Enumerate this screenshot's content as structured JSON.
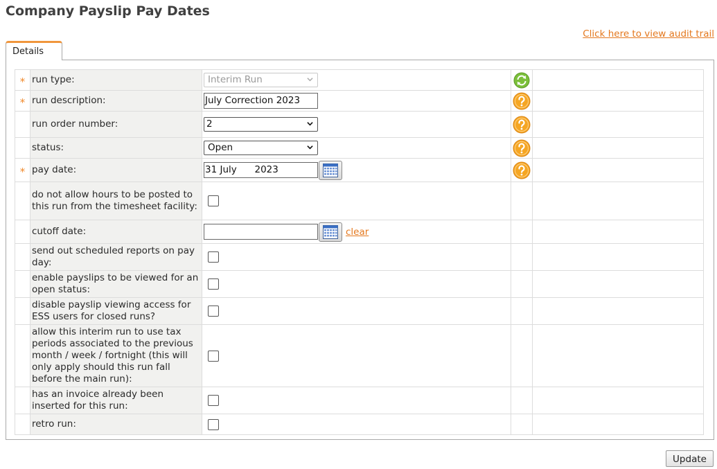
{
  "page": {
    "title": "Company Payslip Pay Dates",
    "audit_link": "Click here to view audit trail",
    "tab_label": "Details",
    "update_label": "Update"
  },
  "fields": {
    "run_type": {
      "required": "*",
      "label": "run type:",
      "value": "Interim Run"
    },
    "run_description": {
      "required": "*",
      "label": "run description:",
      "value": "July Correction 2023"
    },
    "run_order_number": {
      "label": "run order number:",
      "value": "2"
    },
    "status": {
      "label": "status:",
      "value": "Open"
    },
    "pay_date": {
      "required": "*",
      "label": "pay date:",
      "value": "31 July      2023"
    },
    "no_timesheet_hours": {
      "label": "do not allow hours to be posted to this run from the timesheet facility:",
      "checked": false
    },
    "cutoff_date": {
      "label": "cutoff date:",
      "value": "",
      "clear_label": "clear"
    },
    "scheduled_reports": {
      "label": "send out scheduled reports on pay day:",
      "checked": false
    },
    "open_status_viewing": {
      "label": "enable payslips to be viewed for an open status:",
      "checked": false
    },
    "disable_ess_closed": {
      "label": "disable payslip viewing access for ESS users for closed runs?",
      "checked": false
    },
    "previous_tax_periods": {
      "label": "allow this interim run to use tax periods associated to the previous month / week / fortnight (this will only apply should this run fall before the main run):",
      "checked": false
    },
    "invoice_inserted": {
      "label": "has an invoice already been inserted for this run:",
      "checked": false
    },
    "retro_run": {
      "label": "retro run:",
      "checked": false
    }
  },
  "icons": {
    "refresh": "refresh-icon",
    "help": "help-icon",
    "calendar": "calendar-icon",
    "chevron": "chevron-down-icon"
  },
  "colors": {
    "accent_orange": "#e4781e",
    "help_orange": "#f5a623",
    "refresh_green": "#7bbf3a",
    "label_bg": "#f1f1ef"
  }
}
